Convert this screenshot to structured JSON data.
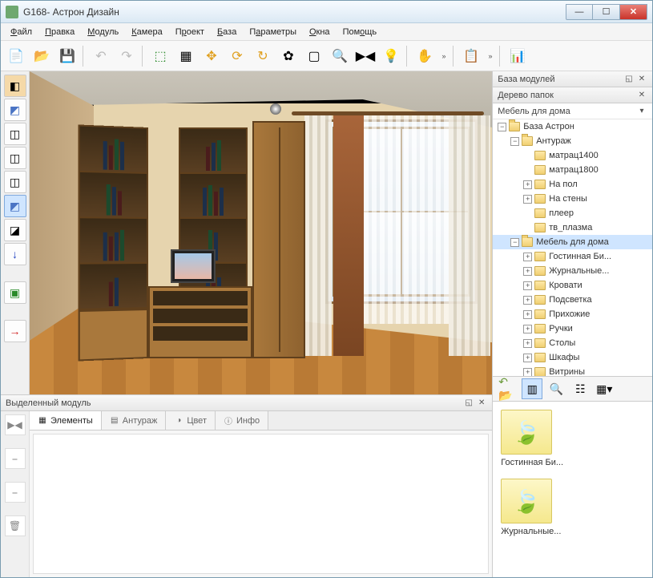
{
  "window": {
    "title": "G168- Астрон Дизайн"
  },
  "menu": [
    "Файл",
    "Правка",
    "Модуль",
    "Камера",
    "Проект",
    "База",
    "Параметры",
    "Окна",
    "Помощь"
  ],
  "side_panel": {
    "title": "База модулей",
    "tree_title": "Дерево папок",
    "root": "Мебель для дома",
    "nodes": [
      {
        "depth": 0,
        "tog": "▾",
        "label": "База Астрон"
      },
      {
        "depth": 1,
        "tog": "▾",
        "label": "Антураж"
      },
      {
        "depth": 2,
        "tog": "",
        "label": "матрац1400"
      },
      {
        "depth": 2,
        "tog": "",
        "label": "матрац1800"
      },
      {
        "depth": 2,
        "tog": "▸",
        "label": "На пол"
      },
      {
        "depth": 2,
        "tog": "▸",
        "label": "На стены"
      },
      {
        "depth": 2,
        "tog": "",
        "label": "плеер"
      },
      {
        "depth": 2,
        "tog": "",
        "label": "тв_плазма"
      },
      {
        "depth": 1,
        "tog": "▾",
        "label": "Мебель для дома",
        "sel": true
      },
      {
        "depth": 2,
        "tog": "▸",
        "label": "Гостинная Би..."
      },
      {
        "depth": 2,
        "tog": "▸",
        "label": "Журнальные..."
      },
      {
        "depth": 2,
        "tog": "▸",
        "label": "Кровати"
      },
      {
        "depth": 2,
        "tog": "▸",
        "label": "Подсветка"
      },
      {
        "depth": 2,
        "tog": "▸",
        "label": "Прихожие"
      },
      {
        "depth": 2,
        "tog": "▸",
        "label": "Ручки"
      },
      {
        "depth": 2,
        "tog": "▸",
        "label": "Столы"
      },
      {
        "depth": 2,
        "tog": "▸",
        "label": "Шкафы"
      },
      {
        "depth": 2,
        "tog": "▸",
        "label": "Витрины"
      }
    ],
    "thumbs": [
      "Гостинная Би...",
      "Журнальные..."
    ]
  },
  "sel_panel": {
    "title": "Выделенный модуль",
    "tabs": [
      "Элементы",
      "Антураж",
      "Цвет",
      "Инфо"
    ]
  }
}
